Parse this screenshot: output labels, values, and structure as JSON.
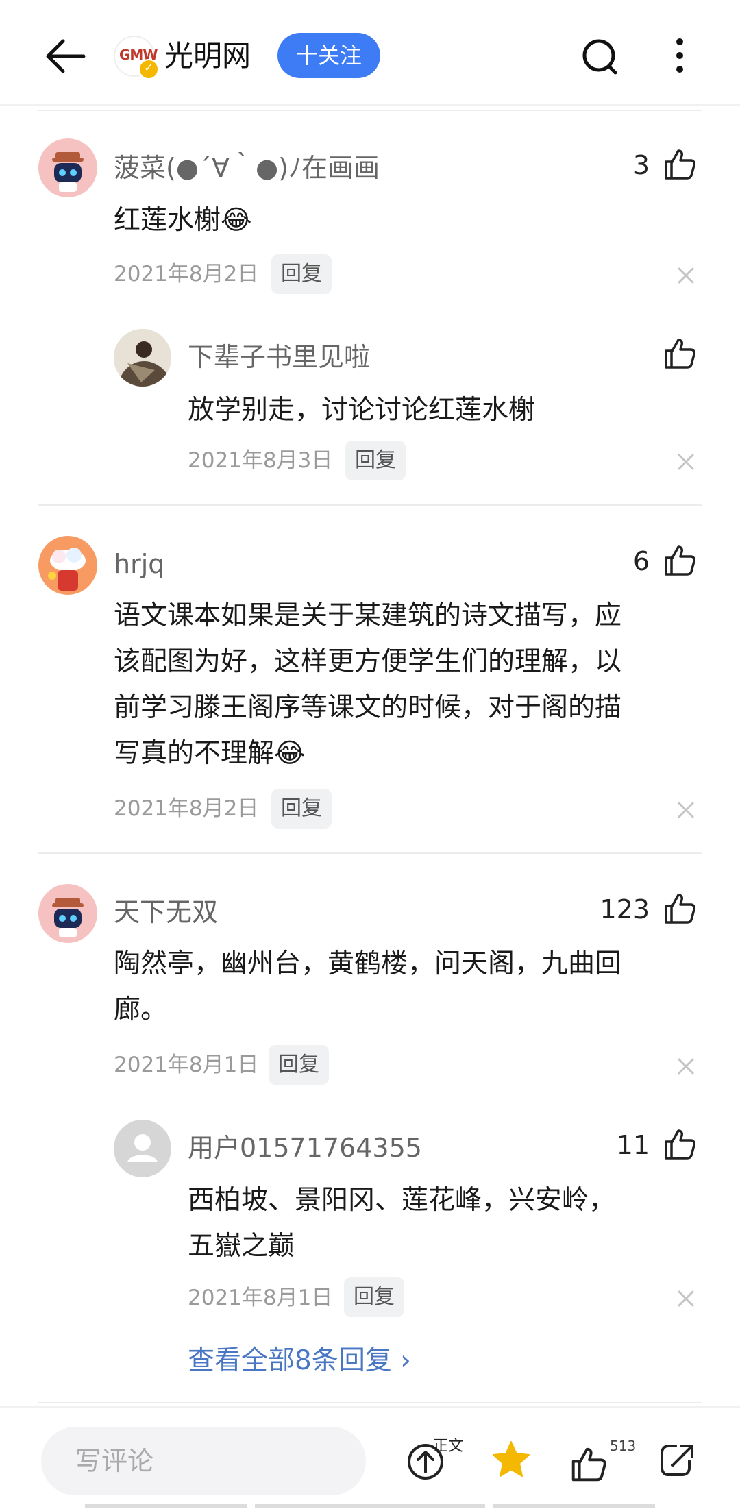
{
  "header": {
    "logo_text": "GMW",
    "site_name": "光明网",
    "follow_label": "十关注"
  },
  "comments": [
    {
      "username": "菠菜(●´∀｀●)ﾉ在画画",
      "likes": "3",
      "text": "红莲水榭😂",
      "date": "2021年8月2日",
      "reply_label": "回复",
      "replies": [
        {
          "username": "下辈子书里见啦",
          "likes": "",
          "text": "放学别走，讨论讨论红莲水榭",
          "date": "2021年8月3日",
          "reply_label": "回复"
        }
      ]
    },
    {
      "username": "hrjq",
      "likes": "6",
      "text_lines": [
        "语文课本如果是关于某建筑的诗文描写，应",
        "该配图为好，这样更方便学生们的理解，以",
        "前学习滕王阁序等课文的时候，对于阁的描",
        "写真的不理解😂"
      ],
      "date": "2021年8月2日",
      "reply_label": "回复"
    },
    {
      "username": "天下无双",
      "likes": "123",
      "text_lines": [
        "陶然亭，幽州台，黄鹤楼，问天阁，九曲回",
        "廊。"
      ],
      "date": "2021年8月1日",
      "reply_label": "回复",
      "replies": [
        {
          "username": "用户01571764355",
          "likes": "11",
          "text_lines": [
            "西柏坡、景阳冈、莲花峰，兴安岭，",
            "五嶽之巅"
          ],
          "date": "2021年8月1日",
          "reply_label": "回复"
        }
      ],
      "view_all_label": "查看全部8条回复 ›"
    }
  ],
  "bottom_bar": {
    "comment_placeholder": "写评论",
    "article_label": "正文",
    "like_count": "513"
  },
  "colors": {
    "accent": "#3d7cf5",
    "link": "#4a77c4",
    "star": "#f5b800"
  },
  "icons": [
    "back-arrow-icon",
    "search-icon",
    "more-vertical-icon",
    "thumbs-up-icon",
    "close-icon",
    "up-arrow-circle-icon",
    "star-icon",
    "share-icon"
  ]
}
